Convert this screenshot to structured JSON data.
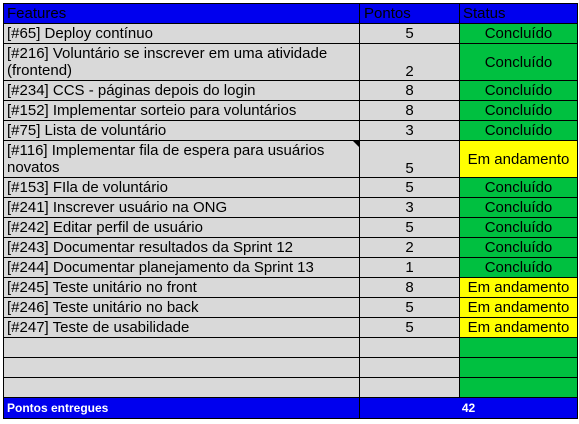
{
  "headers": {
    "features": "Features",
    "points": "Pontos",
    "status": "Status"
  },
  "rows": [
    {
      "feature": "[#65] Deploy contínuo",
      "points": "5",
      "status": "Concluído",
      "state": "done"
    },
    {
      "feature": "[#216] Voluntário se inscrever em uma atividade (frontend)",
      "points": "2",
      "status": "Concluído",
      "state": "done"
    },
    {
      "feature": "[#234] CCS - páginas depois do login",
      "points": "8",
      "status": "Concluído",
      "state": "done"
    },
    {
      "feature": "[#152] Implementar sorteio para voluntários",
      "points": "8",
      "status": "Concluído",
      "state": "done"
    },
    {
      "feature": "[#75] Lista de voluntário",
      "points": "3",
      "status": "Concluído",
      "state": "done"
    },
    {
      "feature": "[#116] Implementar fila de espera para usuários novatos",
      "points": "5",
      "status": "Em andamento",
      "state": "prog"
    },
    {
      "feature": "[#153] FIla de voluntário",
      "points": "5",
      "status": "Concluído",
      "state": "done"
    },
    {
      "feature": "[#241] Inscrever usuário na ONG",
      "points": "3",
      "status": "Concluído",
      "state": "done"
    },
    {
      "feature": "[#242] Editar perfil de usuário",
      "points": "5",
      "status": "Concluído",
      "state": "done"
    },
    {
      "feature": "[#243] Documentar resultados da Sprint 12",
      "points": "2",
      "status": "Concluído",
      "state": "done"
    },
    {
      "feature": "[#244] Documentar planejamento da Sprint 13",
      "points": "1",
      "status": "Concluído",
      "state": "done"
    },
    {
      "feature": "[#245] Teste unitário no front",
      "points": "8",
      "status": "Em andamento",
      "state": "prog"
    },
    {
      "feature": "[#246] Teste unitário no back",
      "points": "5",
      "status": "Em andamento",
      "state": "prog"
    },
    {
      "feature": "[#247] Teste de usabilidade",
      "points": "5",
      "status": "Em andamento",
      "state": "prog"
    }
  ],
  "footer": {
    "label": "Pontos entregues",
    "total": "42"
  },
  "colors": {
    "header": "#0000ee",
    "done": "#00c040",
    "in_progress": "#ffff00",
    "cell": "#d9d9d9"
  }
}
